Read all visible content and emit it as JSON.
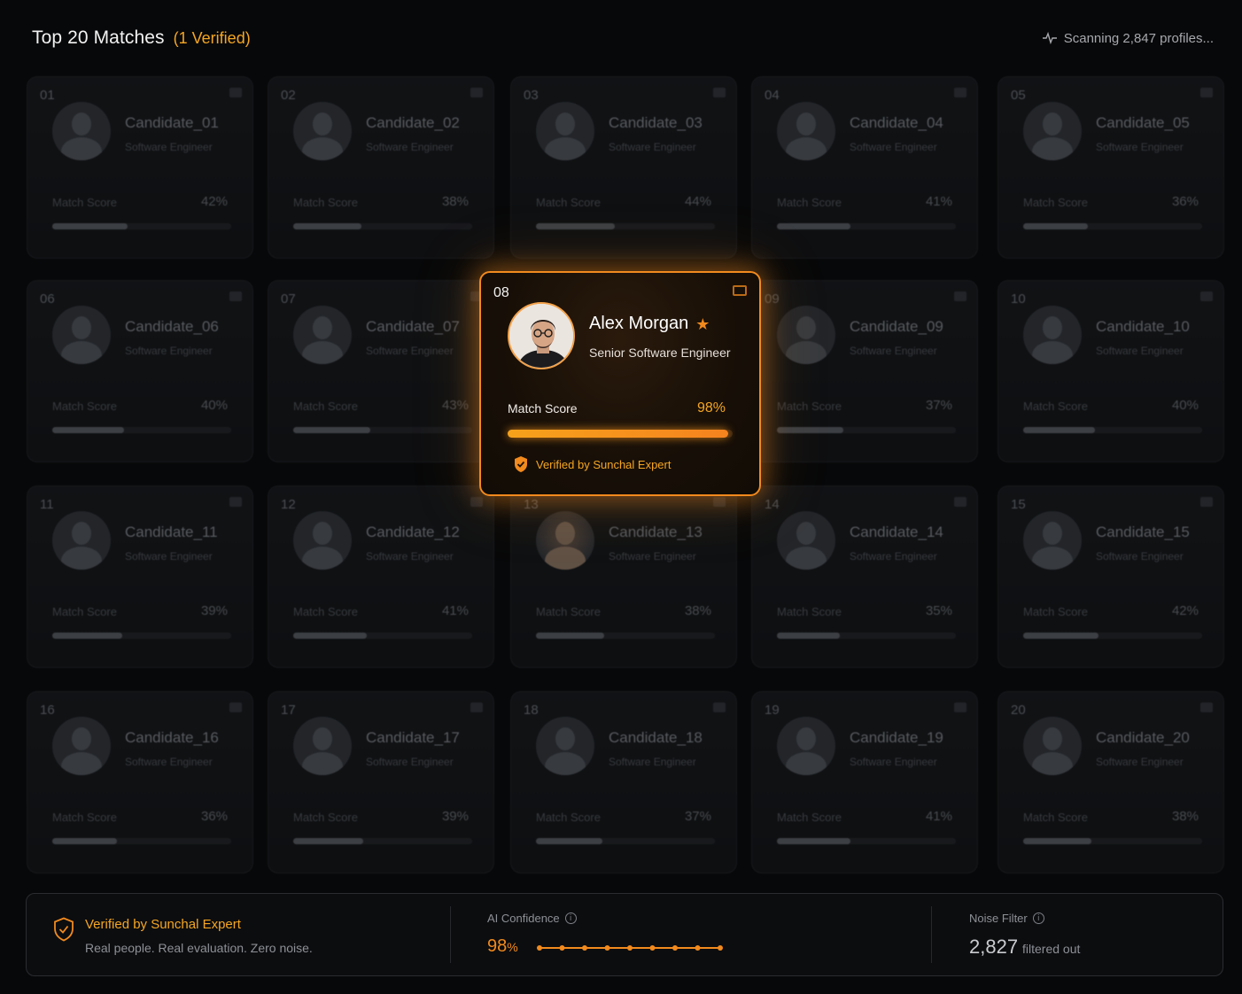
{
  "header": {
    "title": "Top 20 Matches",
    "verified_badge": "(1 Verified)",
    "scanning_text": "Scanning 2,847 profiles..."
  },
  "colors": {
    "accent": "#f28a1e",
    "accent_text": "#f5a623",
    "background": "#070809"
  },
  "match_label": "Match Score",
  "candidates": [
    {
      "num": "01",
      "name": "Candidate_01",
      "role": "Software Engineer",
      "score": "42%",
      "fill": 0.42
    },
    {
      "num": "02",
      "name": "Candidate_02",
      "role": "Software Engineer",
      "score": "38%",
      "fill": 0.38
    },
    {
      "num": "03",
      "name": "Candidate_03",
      "role": "Software Engineer",
      "score": "44%",
      "fill": 0.44
    },
    {
      "num": "04",
      "name": "Candidate_04",
      "role": "Software Engineer",
      "score": "41%",
      "fill": 0.41
    },
    {
      "num": "05",
      "name": "Candidate_05",
      "role": "Software Engineer",
      "score": "36%",
      "fill": 0.36
    },
    {
      "num": "06",
      "name": "Candidate_06",
      "role": "Software Engineer",
      "score": "40%",
      "fill": 0.4
    },
    {
      "num": "07",
      "name": "Candidate_07",
      "role": "Software Engineer",
      "score": "43%",
      "fill": 0.43
    },
    {
      "num": "08",
      "name": "Alex Morgan",
      "role": "Senior Software Engineer",
      "score": "98%",
      "fill": 0.98,
      "featured": true
    },
    {
      "num": "09",
      "name": "Candidate_09",
      "role": "Software Engineer",
      "score": "37%",
      "fill": 0.37
    },
    {
      "num": "10",
      "name": "Candidate_10",
      "role": "Software Engineer",
      "score": "40%",
      "fill": 0.4
    },
    {
      "num": "11",
      "name": "Candidate_11",
      "role": "Software Engineer",
      "score": "39%",
      "fill": 0.39
    },
    {
      "num": "12",
      "name": "Candidate_12",
      "role": "Software Engineer",
      "score": "41%",
      "fill": 0.41
    },
    {
      "num": "13",
      "name": "Candidate_13",
      "role": "Software Engineer",
      "score": "38%",
      "fill": 0.38,
      "warm": true
    },
    {
      "num": "14",
      "name": "Candidate_14",
      "role": "Software Engineer",
      "score": "35%",
      "fill": 0.35
    },
    {
      "num": "15",
      "name": "Candidate_15",
      "role": "Software Engineer",
      "score": "42%",
      "fill": 0.42
    },
    {
      "num": "16",
      "name": "Candidate_16",
      "role": "Software Engineer",
      "score": "36%",
      "fill": 0.36
    },
    {
      "num": "17",
      "name": "Candidate_17",
      "role": "Software Engineer",
      "score": "39%",
      "fill": 0.39
    },
    {
      "num": "18",
      "name": "Candidate_18",
      "role": "Software Engineer",
      "score": "37%",
      "fill": 0.37
    },
    {
      "num": "19",
      "name": "Candidate_19",
      "role": "Software Engineer",
      "score": "41%",
      "fill": 0.41
    },
    {
      "num": "20",
      "name": "Candidate_20",
      "role": "Software Engineer",
      "score": "38%",
      "fill": 0.38
    }
  ],
  "featured": {
    "num": "08",
    "name": "Alex Morgan",
    "role": "Senior Software Engineer",
    "match_label": "Match Score",
    "score": "98%",
    "fill": 0.98,
    "verified_text": "Verified by Sunchal Expert",
    "icons": [
      "star-icon",
      "shield-check-icon",
      "bookmark-icon"
    ]
  },
  "footer": {
    "verified_title": "Verified by Sunchal Expert",
    "verified_sub": "Real people. Real evaluation. Zero noise.",
    "confidence_label": "AI Confidence",
    "confidence_value": "98",
    "confidence_unit": "%",
    "noise_label": "Noise Filter",
    "noise_value": "2,827",
    "noise_sub": "filtered out"
  }
}
